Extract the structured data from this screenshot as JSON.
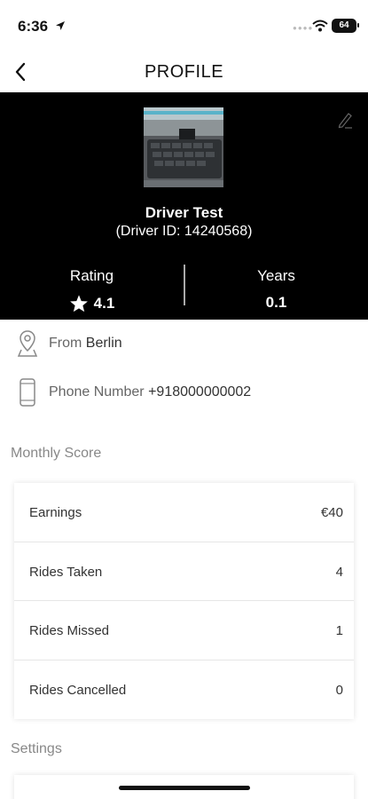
{
  "status_bar": {
    "time": "6:36",
    "battery": "64"
  },
  "nav": {
    "title": "PROFILE"
  },
  "profile": {
    "name": "Driver Test",
    "driver_id": "(Driver ID: 14240568)",
    "rating_label": "Rating",
    "rating_value": "4.1",
    "years_label": "Years",
    "years_value": "0.1"
  },
  "info": {
    "from_label": "From",
    "from_value": "Berlin",
    "phone_label": "Phone Number",
    "phone_value": "+918000000002"
  },
  "monthly_score": {
    "title": "Monthly Score",
    "rows": [
      {
        "label": "Earnings",
        "value": "€40"
      },
      {
        "label": "Rides Taken",
        "value": "4"
      },
      {
        "label": "Rides Missed",
        "value": "1"
      },
      {
        "label": "Rides Cancelled",
        "value": "0"
      }
    ]
  },
  "settings": {
    "title": "Settings"
  },
  "icons": {
    "back": "chevron-left-icon",
    "edit": "pencil-icon",
    "rating": "star-icon",
    "location": "location-pin-icon",
    "phone": "phone-icon"
  },
  "colors": {
    "hero_background": "#000000",
    "label_gray": "#888888"
  }
}
